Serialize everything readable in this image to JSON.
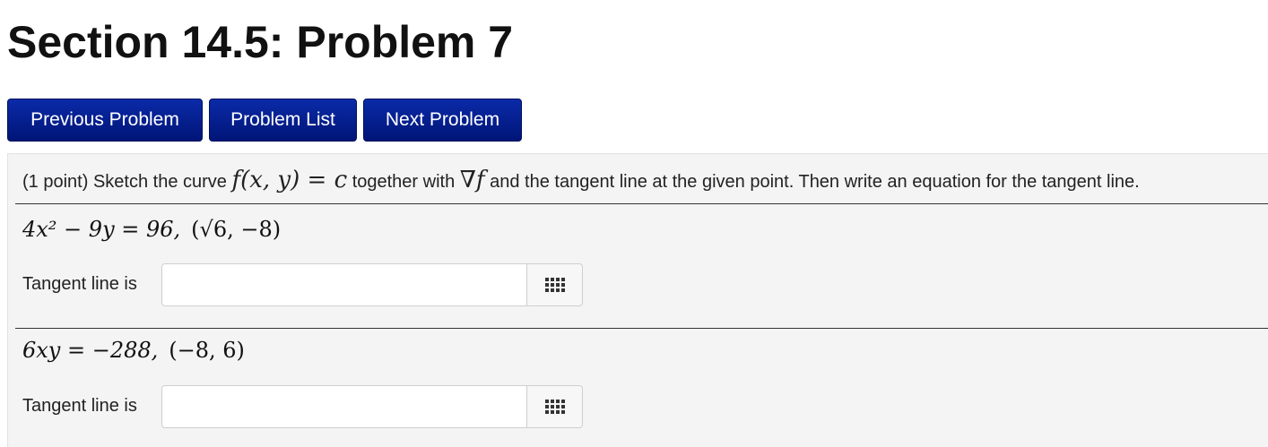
{
  "page": {
    "title": "Section 14.5: Problem 7"
  },
  "nav": {
    "previous_label": "Previous Problem",
    "list_label": "Problem List",
    "next_label": "Next Problem"
  },
  "problem": {
    "points": "(1 point)",
    "text_before_curve": "Sketch the curve",
    "curve_expr": "f(x, y) = c",
    "text_together": "together with",
    "grad_expr": "∇f",
    "text_after": "and the tangent line at the given point. Then write an equation for the tangent line.",
    "parts": [
      {
        "equation": "4x² − 9y = 96,",
        "point": "(√6, −8)",
        "label": "Tangent line is",
        "value": ""
      },
      {
        "equation": "6xy = −288,",
        "point": "(−8, 6)",
        "label": "Tangent line is",
        "value": ""
      }
    ]
  },
  "icons": {
    "palette": "equation-palette-icon"
  },
  "colors": {
    "button_bg": "#001577",
    "panel_bg": "#f4f4f4"
  }
}
